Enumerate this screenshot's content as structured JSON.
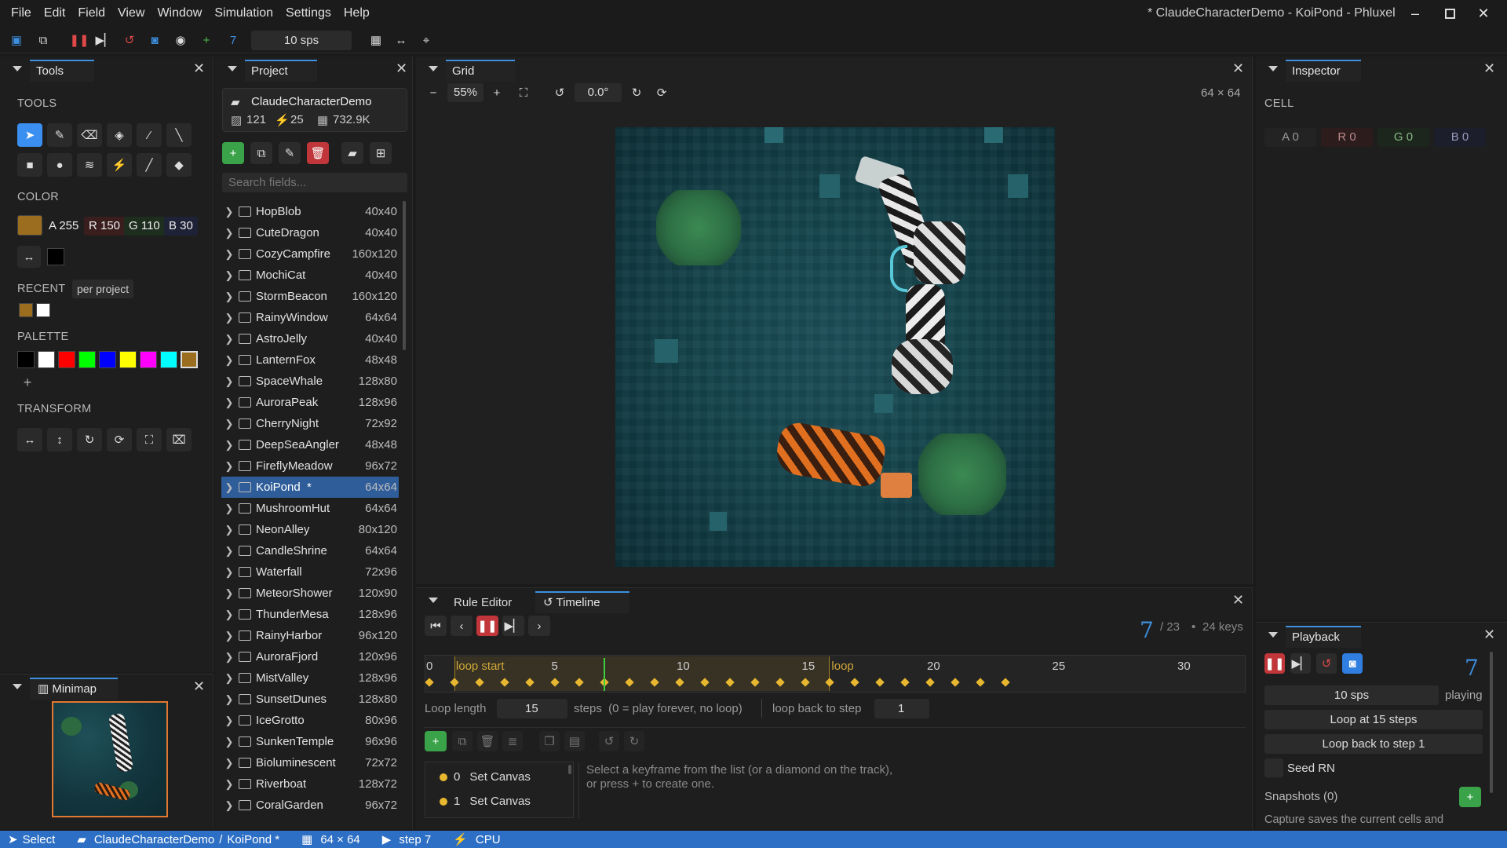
{
  "app": {
    "title": "* ClaudeCharacterDemo - KoiPond - Phluxel"
  },
  "menu": [
    "File",
    "Edit",
    "Field",
    "View",
    "Window",
    "Simulation",
    "Settings",
    "Help"
  ],
  "toolbar": {
    "step": "7",
    "sps": "10 sps"
  },
  "tools_panel": {
    "title": "Tools",
    "tools_heading": "TOOLS",
    "color_heading": "COLOR",
    "a": "A 255",
    "r": "R 150",
    "g": "G 110",
    "b": "B 30",
    "recent_heading": "RECENT",
    "recent_scope": "per project",
    "palette_heading": "PALETTE",
    "transform_heading": "TRANSFORM",
    "color_hex": "#9a6e1e"
  },
  "minimap": {
    "title": "Minimap"
  },
  "project": {
    "title": "Project",
    "name": "ClaudeCharacterDemo",
    "count_images": "121",
    "count_rules": "25",
    "size": "732.9K",
    "search_placeholder": "Search fields...",
    "items": [
      {
        "name": "HopBlob",
        "size": "40x40"
      },
      {
        "name": "CuteDragon",
        "size": "40x40"
      },
      {
        "name": "CozyCampfire",
        "size": "160x120"
      },
      {
        "name": "MochiCat",
        "size": "40x40"
      },
      {
        "name": "StormBeacon",
        "size": "160x120"
      },
      {
        "name": "RainyWindow",
        "size": "64x64"
      },
      {
        "name": "AstroJelly",
        "size": "40x40"
      },
      {
        "name": "LanternFox",
        "size": "48x48"
      },
      {
        "name": "SpaceWhale",
        "size": "128x80"
      },
      {
        "name": "AuroraPeak",
        "size": "128x96"
      },
      {
        "name": "CherryNight",
        "size": "72x92"
      },
      {
        "name": "DeepSeaAngler",
        "size": "48x48"
      },
      {
        "name": "FireflyMeadow",
        "size": "96x72"
      },
      {
        "name": "KoiPond  *",
        "size": "64x64"
      },
      {
        "name": "MushroomHut",
        "size": "64x64"
      },
      {
        "name": "NeonAlley",
        "size": "80x120"
      },
      {
        "name": "CandleShrine",
        "size": "64x64"
      },
      {
        "name": "Waterfall",
        "size": "72x96"
      },
      {
        "name": "MeteorShower",
        "size": "120x90"
      },
      {
        "name": "ThunderMesa",
        "size": "128x96"
      },
      {
        "name": "RainyHarbor",
        "size": "96x120"
      },
      {
        "name": "AuroraFjord",
        "size": "120x96"
      },
      {
        "name": "MistValley",
        "size": "128x96"
      },
      {
        "name": "SunsetDunes",
        "size": "128x80"
      },
      {
        "name": "IceGrotto",
        "size": "80x96"
      },
      {
        "name": "SunkenTemple",
        "size": "96x96"
      },
      {
        "name": "Bioluminescent",
        "size": "72x72"
      },
      {
        "name": "Riverboat",
        "size": "128x72"
      },
      {
        "name": "CoralGarden",
        "size": "96x72"
      }
    ]
  },
  "grid": {
    "title": "Grid",
    "zoom": "55%",
    "rotation": "0.0°",
    "dims": "64 × 64"
  },
  "inspector": {
    "title": "Inspector",
    "cell_heading": "CELL",
    "a": "A 0",
    "r": "R 0",
    "g": "G 0",
    "b": "B 0"
  },
  "bottom": {
    "tab_rules": "Rule Editor",
    "tab_timeline": "Timeline",
    "step": "7",
    "total": "/ 23",
    "keys": "24 keys",
    "loop_start": "loop start",
    "loop_end": "loop",
    "ticks": [
      "0",
      "5",
      "10",
      "15",
      "20",
      "25",
      "30"
    ],
    "loop_length_label": "Loop length",
    "loop_length": "15",
    "steps_note": "steps  (0 = play forever, no loop)",
    "loop_back_label": "loop back to step",
    "loop_back": "1",
    "keyframes": [
      {
        "idx": "0",
        "name": "Set Canvas"
      },
      {
        "idx": "1",
        "name": "Set Canvas"
      }
    ],
    "hint1": "Select a keyframe from the list (or a diamond on the track),",
    "hint2": "or press + to create one.",
    "current_step": 7,
    "loop_start_step": 1,
    "loop_end_step": 16,
    "keyframe_steps": [
      0,
      1,
      2,
      3,
      4,
      5,
      6,
      7,
      8,
      9,
      10,
      11,
      12,
      13,
      14,
      15,
      16,
      17,
      18,
      19,
      20,
      21,
      22,
      23
    ]
  },
  "playback": {
    "title": "Playback",
    "step": "7",
    "sps": "10 sps",
    "state": "playing",
    "loop_at": "Loop at 15 steps",
    "loop_back": "Loop back to step 1",
    "seed": "Seed RN",
    "snapshots": "Snapshots (0)",
    "capture": "Capture saves the current cells and"
  },
  "status": {
    "tool": "Select",
    "project": "ClaudeCharacterDemo",
    "sep": "/",
    "field": "KoiPond *",
    "dims": "64 × 64",
    "step": "step 7",
    "engine": "CPU"
  }
}
